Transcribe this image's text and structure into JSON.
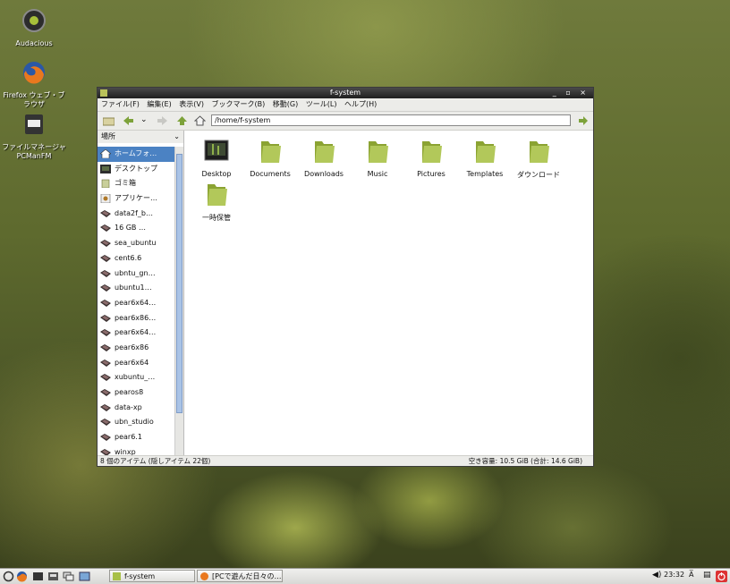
{
  "desktop": {
    "icons": [
      {
        "label": "Audacious",
        "icon": "audacious-icon"
      },
      {
        "label": "Firefox ウェブ・ブラウザ",
        "icon": "firefox-icon"
      },
      {
        "label": "ファイルマネージャ PCManFM",
        "icon": "file-manager-icon"
      }
    ]
  },
  "window": {
    "title": "f-system",
    "controls": "_ ▫ ×",
    "menu": [
      "ファイル(F)",
      "編集(E)",
      "表示(V)",
      "ブックマーク(B)",
      "移動(G)",
      "ツール(L)",
      "ヘルプ(H)"
    ],
    "path": "/home/f-system",
    "sidebar": {
      "header": "場所",
      "items": [
        {
          "label": "ホームフォ…",
          "icon": "home-icon",
          "selected": true
        },
        {
          "label": "デスクトップ",
          "icon": "desktop-icon"
        },
        {
          "label": "ゴミ箱",
          "icon": "trash-icon"
        },
        {
          "label": "アプリケー…",
          "icon": "applications-icon"
        },
        {
          "label": "data2f_b…",
          "icon": "drive-icon"
        },
        {
          "label": "16 GB …",
          "icon": "drive-icon"
        },
        {
          "label": "sea_ubuntu",
          "icon": "drive-icon"
        },
        {
          "label": "cent6.6",
          "icon": "drive-icon"
        },
        {
          "label": "ubntu_gn…",
          "icon": "drive-icon"
        },
        {
          "label": "ubuntu1…",
          "icon": "drive-icon"
        },
        {
          "label": "pear6x64…",
          "icon": "drive-icon"
        },
        {
          "label": "pear6x86…",
          "icon": "drive-icon"
        },
        {
          "label": "pear6x64…",
          "icon": "drive-icon"
        },
        {
          "label": "pear6x86",
          "icon": "drive-icon"
        },
        {
          "label": "pear6x64",
          "icon": "drive-icon"
        },
        {
          "label": "xubuntu_…",
          "icon": "drive-icon"
        },
        {
          "label": "pearos8",
          "icon": "drive-icon"
        },
        {
          "label": "data-xp",
          "icon": "drive-icon"
        },
        {
          "label": "ubn_studio",
          "icon": "drive-icon"
        },
        {
          "label": "pear6.1",
          "icon": "drive-icon"
        },
        {
          "label": "winxp",
          "icon": "drive-icon"
        }
      ]
    },
    "files": [
      {
        "label": "Desktop",
        "icon": "desktop-folder-icon"
      },
      {
        "label": "Documents",
        "icon": "folder-icon"
      },
      {
        "label": "Downloads",
        "icon": "folder-icon"
      },
      {
        "label": "Music",
        "icon": "folder-icon"
      },
      {
        "label": "Pictures",
        "icon": "folder-icon"
      },
      {
        "label": "Templates",
        "icon": "folder-icon"
      },
      {
        "label": "ダウンロード",
        "icon": "folder-icon"
      },
      {
        "label": "一時保管",
        "icon": "folder-icon"
      }
    ],
    "status_left": "8 個のアイテム (隠しアイテム 22個)",
    "status_right": "空き容量: 10.5 GiB (合計: 14.6 GiB)"
  },
  "taskbar": {
    "tasks": [
      {
        "label": "f-system",
        "icon": "folder-icon"
      },
      {
        "label": "[PCで遊んだ日々の…",
        "icon": "firefox-icon"
      }
    ],
    "clock": "23:32",
    "ime": "A̅"
  },
  "colors": {
    "selection": "#4b82c3",
    "folder": "#a8c048",
    "titlebar": "#2a2a2a"
  }
}
